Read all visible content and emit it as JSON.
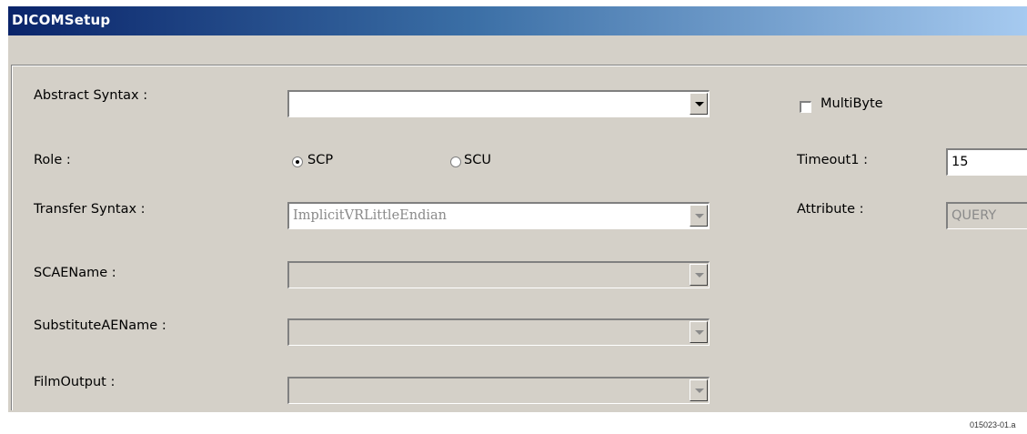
{
  "window": {
    "title": "DICOMSetup"
  },
  "form": {
    "abstract_syntax": {
      "label": "Abstract Syntax :",
      "value": ""
    },
    "multibyte": {
      "label": "MultiByte",
      "checked": false
    },
    "role": {
      "label": "Role :",
      "options": [
        "SCP",
        "SCU"
      ],
      "selected": "SCP"
    },
    "timeout1": {
      "label": "Timeout1 :",
      "value": "15"
    },
    "transfer_syntax": {
      "label": "Transfer Syntax :",
      "value": "ImplicitVRLittleEndian"
    },
    "attribute": {
      "label": "Attribute :",
      "value": "QUERY"
    },
    "scae_name": {
      "label": "SCAEName :",
      "value": ""
    },
    "substitute_ae_name": {
      "label": "SubstituteAEName :",
      "value": ""
    },
    "film_output": {
      "label": "FilmOutput :",
      "value": ""
    }
  },
  "figure_id": "015023-01.a"
}
